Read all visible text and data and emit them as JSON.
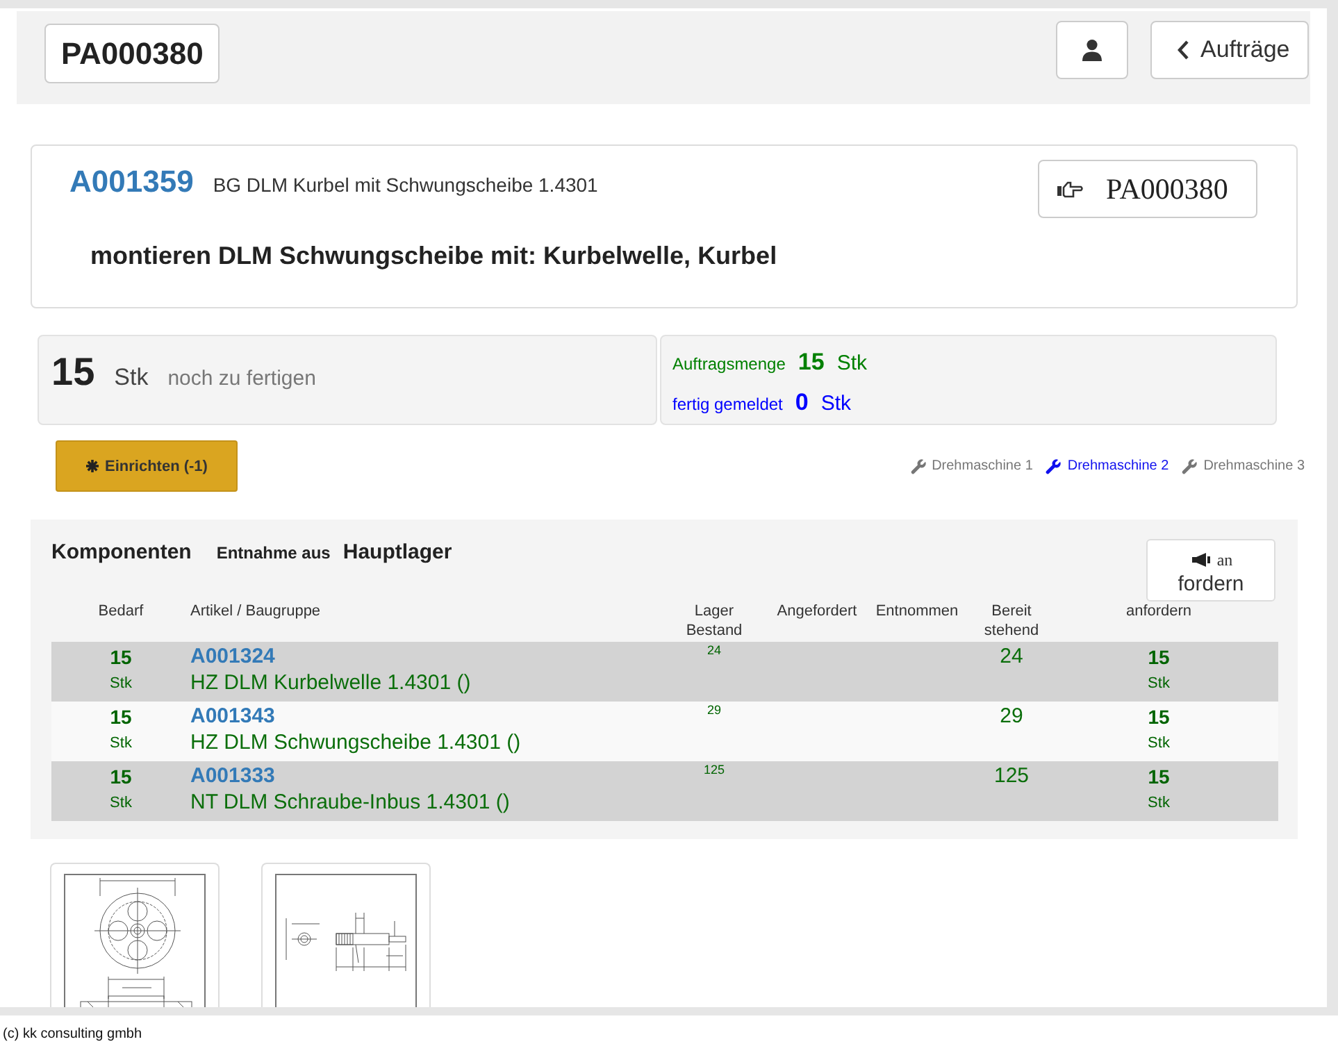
{
  "header": {
    "order_number": "PA000380",
    "back_button": "Aufträge"
  },
  "article": {
    "number": "A001359",
    "name": "BG DLM Kurbel mit Schwungscheibe 1.4301",
    "order_button": "PA000380",
    "operation": "montieren DLM Schwungscheibe mit: Kurbelwelle, Kurbel"
  },
  "quantity": {
    "remaining": "15",
    "remaining_unit": "Stk",
    "remaining_label": "noch zu fertigen",
    "ordered_label": "Auftragsmenge",
    "ordered": "15",
    "ordered_unit": "Stk",
    "reported_label": "fertig gemeldet",
    "reported": "0",
    "reported_unit": "Stk"
  },
  "setup_button": "Einrichten (-1)",
  "machines": [
    {
      "label": "Drehmaschine 1",
      "selected": false
    },
    {
      "label": "Drehmaschine 2",
      "selected": true
    },
    {
      "label": "Drehmaschine 3",
      "selected": false
    }
  ],
  "components": {
    "title": "Komponenten",
    "source_label": "Entnahme aus",
    "source": "Hauptlager",
    "request_button": {
      "line_1": "an",
      "line_2": "fordern"
    },
    "columns": [
      "Bedarf",
      "Artikel / Baugruppe",
      "Lager Bestand",
      "Angefordert",
      "Entnommen",
      "Bereit stehend",
      "anfordern"
    ],
    "rows": [
      {
        "demand": "15",
        "demand_unit": "Stk",
        "article": "A001324",
        "description": "HZ DLM Kurbelwelle 1.4301 ()",
        "stock": "24",
        "ready": "24",
        "request": "15",
        "request_unit": "Stk"
      },
      {
        "demand": "15",
        "demand_unit": "Stk",
        "article": "A001343",
        "description": "HZ DLM Schwungscheibe 1.4301 ()",
        "stock": "29",
        "ready": "29",
        "request": "15",
        "request_unit": "Stk"
      },
      {
        "demand": "15",
        "demand_unit": "Stk",
        "article": "A001333",
        "description": "NT DLM Schraube-Inbus 1.4301 ()",
        "stock": "125",
        "ready": "125",
        "request": "15",
        "request_unit": "Stk"
      }
    ]
  },
  "drawings": [
    {
      "kind": "disc"
    },
    {
      "kind": "shaft"
    }
  ],
  "footer": "(c) kk consulting gmbh"
}
